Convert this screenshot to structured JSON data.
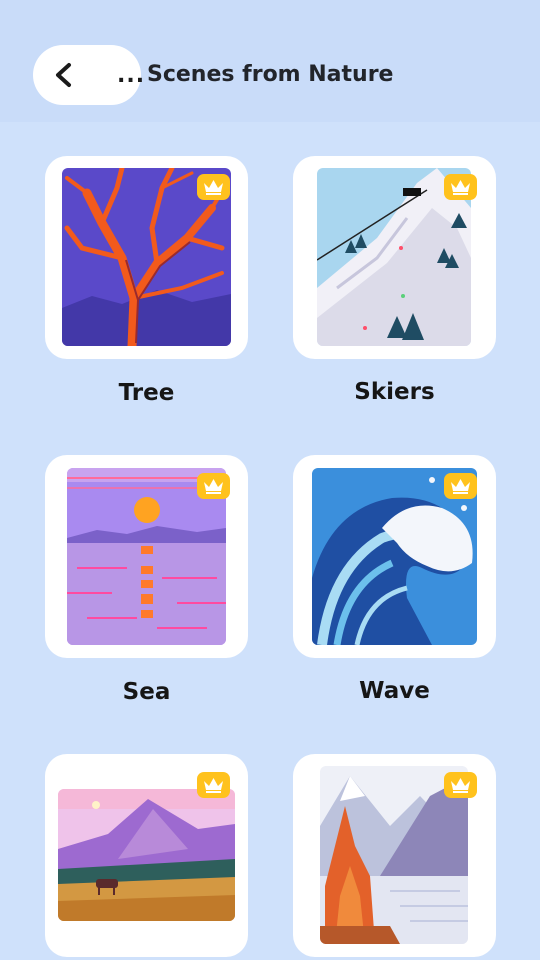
{
  "header": {
    "back_ellipsis": "...",
    "title": "Scenes from Nature",
    "background": "#c9dcf9"
  },
  "colors": {
    "page_background": "#cfe1fb",
    "card_background": "#ffffff",
    "premium_badge": "#ffc21d"
  },
  "icons": {
    "back": "chevron-left-icon",
    "premium": "crown-icon"
  },
  "grid": {
    "items": [
      {
        "label": "Tree",
        "premium": true
      },
      {
        "label": "Skiers",
        "premium": true
      },
      {
        "label": "Sea",
        "premium": true
      },
      {
        "label": "Wave",
        "premium": true
      },
      {
        "label": "",
        "premium": true
      },
      {
        "label": "",
        "premium": true
      }
    ]
  }
}
